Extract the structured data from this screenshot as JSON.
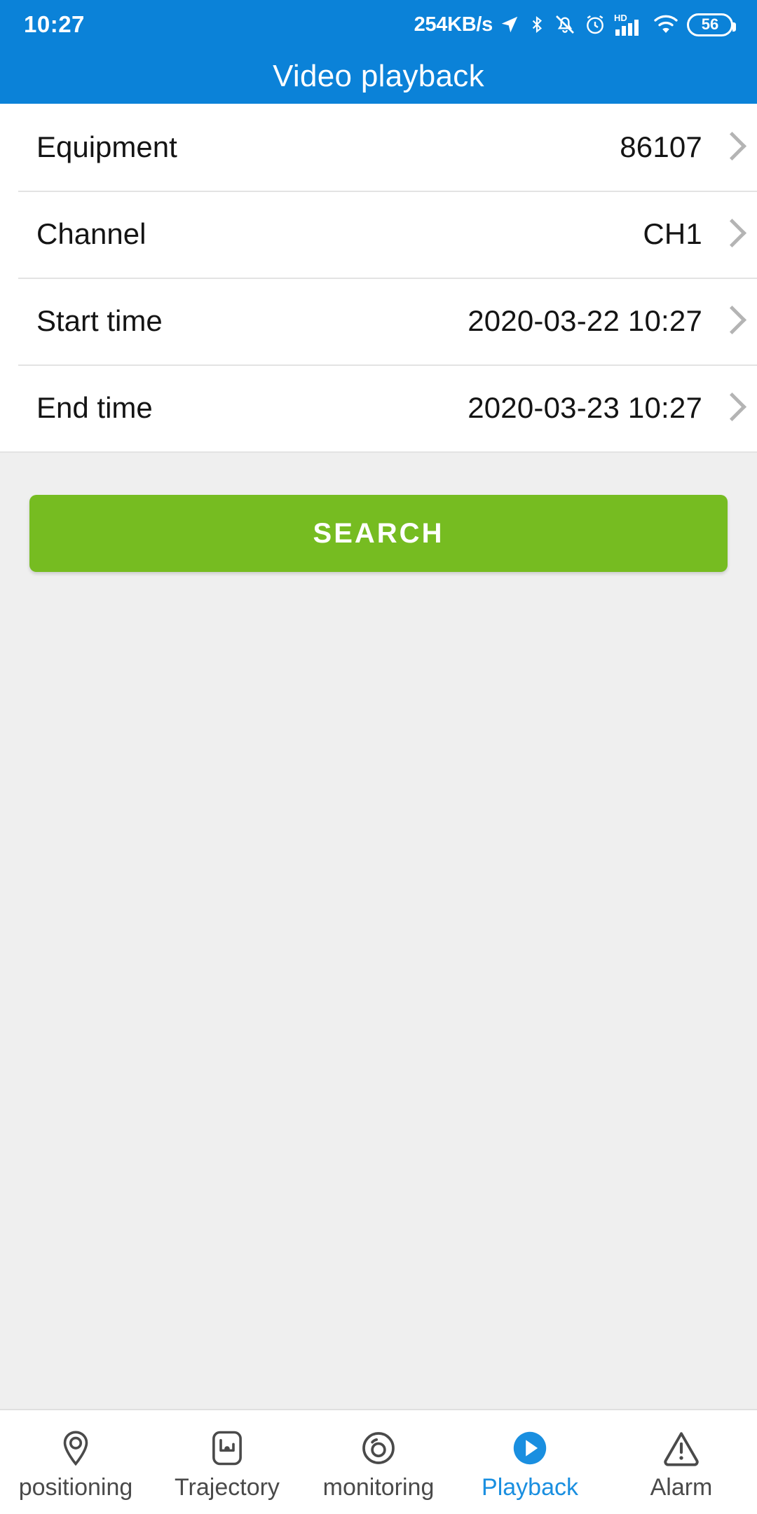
{
  "status_bar": {
    "clock": "10:27",
    "net_speed": "254KB/s",
    "battery_level": "56",
    "icons": [
      "location-arrow-icon",
      "bluetooth-icon",
      "bell-muted-icon",
      "alarm-clock-icon",
      "hd-signal-icon",
      "wifi-icon",
      "battery-icon"
    ]
  },
  "header": {
    "title": "Video playback",
    "background_color": "#0b82d8"
  },
  "form": {
    "rows": [
      {
        "label": "Equipment",
        "value": "86107"
      },
      {
        "label": "Channel",
        "value": "CH1"
      },
      {
        "label": "Start time",
        "value": "2020-03-22 10:27"
      },
      {
        "label": "End time",
        "value": "2020-03-23 10:27"
      }
    ]
  },
  "actions": {
    "search_label": "SEARCH",
    "search_color": "#76bc21"
  },
  "bottom_nav": {
    "active_color": "#1a8fe0",
    "items": [
      {
        "label": "positioning",
        "icon": "map-pin-icon",
        "active": false
      },
      {
        "label": "Trajectory",
        "icon": "route-icon",
        "active": false
      },
      {
        "label": "monitoring",
        "icon": "camera-lens-icon",
        "active": false
      },
      {
        "label": "Playback",
        "icon": "play-circle-icon",
        "active": true
      },
      {
        "label": "Alarm",
        "icon": "warning-triangle-icon",
        "active": false
      }
    ]
  }
}
